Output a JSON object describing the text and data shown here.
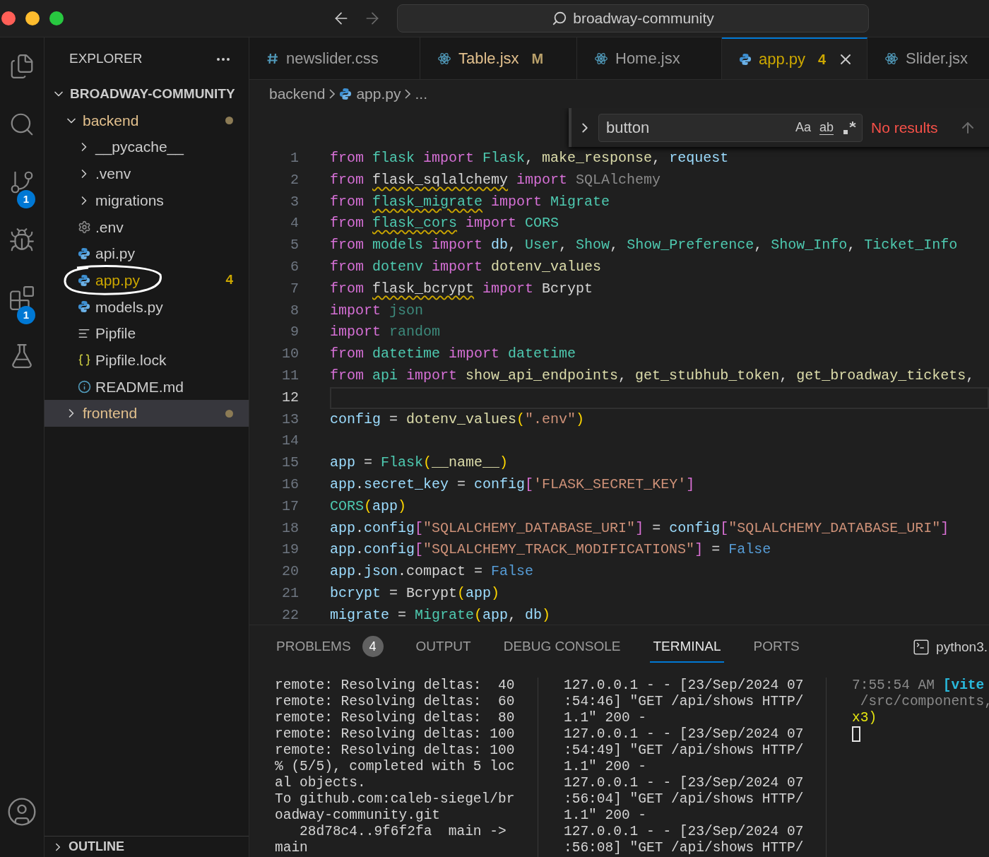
{
  "title_bar": {
    "nav": {
      "back": {
        "disabled": false
      },
      "forward": {
        "disabled": true
      }
    },
    "command_center": "broadway-community"
  },
  "activity_bar": [
    {
      "kind": "files",
      "selected": false
    },
    {
      "kind": "search",
      "selected": false
    },
    {
      "kind": "scm",
      "selected": false,
      "badge": "1"
    },
    {
      "kind": "debug",
      "selected": false
    },
    {
      "kind": "extensions",
      "selected": false,
      "badge": "1"
    },
    {
      "kind": "testing",
      "selected": false
    }
  ],
  "sidebar": {
    "title": "EXPLORER",
    "tree": [
      {
        "label": "BROADWAY-COMMUNITY",
        "kind": "root",
        "modified": false,
        "problems": false,
        "selected": false,
        "expanded": true,
        "circled": false,
        "children": [
          {
            "label": "backend",
            "kind": "folder",
            "modified": true,
            "problems": false,
            "selected": false,
            "expanded": true,
            "circled": false,
            "children": [
              {
                "label": "__pycache__",
                "kind": "folder",
                "modified": false,
                "problems": false,
                "selected": false,
                "expanded": false,
                "circled": false
              },
              {
                "label": ".venv",
                "kind": "folder",
                "modified": false,
                "problems": false,
                "selected": false,
                "expanded": false,
                "circled": false
              },
              {
                "label": "migrations",
                "kind": "folder",
                "modified": false,
                "problems": false,
                "selected": false,
                "expanded": false,
                "circled": false
              },
              {
                "label": ".env",
                "kind": "env",
                "modified": false,
                "problems": false,
                "selected": false,
                "circled": false
              },
              {
                "label": "api.py",
                "kind": "python",
                "modified": false,
                "problems": false,
                "selected": false,
                "circled": false
              },
              {
                "label": "app.py",
                "kind": "python",
                "modified": false,
                "problems": true,
                "badge": "4",
                "selected": false,
                "circled": true
              },
              {
                "label": "models.py",
                "kind": "python",
                "modified": false,
                "problems": false,
                "selected": false,
                "circled": false
              },
              {
                "label": "Pipfile",
                "kind": "text",
                "modified": false,
                "problems": false,
                "selected": false,
                "circled": false
              },
              {
                "label": "Pipfile.lock",
                "kind": "json",
                "modified": false,
                "problems": false,
                "selected": false,
                "circled": false
              },
              {
                "label": "README.md",
                "kind": "info",
                "modified": false,
                "problems": false,
                "selected": false,
                "circled": false
              }
            ]
          },
          {
            "label": "frontend",
            "kind": "folder",
            "modified": true,
            "problems": false,
            "selected": true,
            "expanded": false,
            "circled": false
          }
        ]
      }
    ],
    "outline": {
      "label": "OUTLINE",
      "expanded": false
    }
  },
  "tabs": [
    {
      "label": "newslider.css",
      "kind": "css",
      "modified": false,
      "problems": false,
      "selected": false
    },
    {
      "label": "Table.jsx",
      "kind": "react",
      "modified": true,
      "problems": false,
      "badge": "M",
      "selected": false
    },
    {
      "label": "Home.jsx",
      "kind": "react",
      "modified": false,
      "problems": false,
      "selected": false
    },
    {
      "label": "app.py",
      "kind": "python",
      "modified": false,
      "problems": true,
      "badge": "4",
      "selected": true
    },
    {
      "label": "Slider.jsx",
      "kind": "react",
      "modified": false,
      "problems": false,
      "selected": false
    }
  ],
  "breadcrumbs": [
    {
      "text": "backend",
      "kind": "folder"
    },
    {
      "text": "app.py",
      "kind": "python"
    },
    {
      "text": "...",
      "kind": "more"
    }
  ],
  "find": {
    "value": "button",
    "toggles": [
      "Aa",
      "ab"
    ],
    "result": "No results"
  },
  "code": [
    {
      "n": "1",
      "current": false,
      "tokens": [
        {
          "kind": "kw",
          "text": "from "
        },
        {
          "kind": "mod",
          "text": "flask "
        },
        {
          "kind": "kw",
          "text": "import "
        },
        {
          "kind": "mod",
          "text": "Flask"
        },
        {
          "kind": "plain",
          "text": ", "
        },
        {
          "kind": "fn",
          "text": "make_response"
        },
        {
          "kind": "plain",
          "text": ", "
        },
        {
          "kind": "var",
          "text": "request"
        }
      ]
    },
    {
      "n": "2",
      "current": false,
      "tokens": [
        {
          "kind": "kw",
          "text": "from "
        },
        {
          "kind": "warn",
          "text": "flask_sqlalchemy"
        },
        {
          "kind": "kw",
          "text": " import "
        },
        {
          "kind": "dim",
          "text": "SQLAlchemy"
        }
      ]
    },
    {
      "n": "3",
      "current": false,
      "tokens": [
        {
          "kind": "kw",
          "text": "from "
        },
        {
          "kind": "modwarn",
          "text": "flask_migrate"
        },
        {
          "kind": "kw",
          "text": " import "
        },
        {
          "kind": "mod",
          "text": "Migrate"
        }
      ]
    },
    {
      "n": "4",
      "current": false,
      "tokens": [
        {
          "kind": "kw",
          "text": "from "
        },
        {
          "kind": "modwarn",
          "text": "flask_cors"
        },
        {
          "kind": "kw",
          "text": " import "
        },
        {
          "kind": "mod",
          "text": "CORS"
        }
      ]
    },
    {
      "n": "5",
      "current": false,
      "tokens": [
        {
          "kind": "kw",
          "text": "from "
        },
        {
          "kind": "mod",
          "text": "models "
        },
        {
          "kind": "kw",
          "text": "import "
        },
        {
          "kind": "var",
          "text": "db"
        },
        {
          "kind": "plain",
          "text": ", "
        },
        {
          "kind": "mod",
          "text": "User"
        },
        {
          "kind": "plain",
          "text": ", "
        },
        {
          "kind": "mod",
          "text": "Show"
        },
        {
          "kind": "plain",
          "text": ", "
        },
        {
          "kind": "mod",
          "text": "Show_Preference"
        },
        {
          "kind": "plain",
          "text": ", "
        },
        {
          "kind": "mod",
          "text": "Show_Info"
        },
        {
          "kind": "plain",
          "text": ", "
        },
        {
          "kind": "mod",
          "text": "Ticket_Info"
        }
      ]
    },
    {
      "n": "6",
      "current": false,
      "tokens": [
        {
          "kind": "kw",
          "text": "from "
        },
        {
          "kind": "mod",
          "text": "dotenv "
        },
        {
          "kind": "kw",
          "text": "import "
        },
        {
          "kind": "fn",
          "text": "dotenv_values"
        }
      ]
    },
    {
      "n": "7",
      "current": false,
      "tokens": [
        {
          "kind": "kw",
          "text": "from "
        },
        {
          "kind": "warn",
          "text": "flask_bcrypt"
        },
        {
          "kind": "kw",
          "text": " import "
        },
        {
          "kind": "plain",
          "text": "Bcrypt"
        }
      ]
    },
    {
      "n": "8",
      "current": false,
      "tokens": [
        {
          "kind": "kw",
          "text": "import "
        },
        {
          "kind": "dimmod",
          "text": "json"
        }
      ]
    },
    {
      "n": "9",
      "current": false,
      "tokens": [
        {
          "kind": "kw",
          "text": "import "
        },
        {
          "kind": "dimmod",
          "text": "random"
        }
      ]
    },
    {
      "n": "10",
      "current": false,
      "tokens": [
        {
          "kind": "kw",
          "text": "from "
        },
        {
          "kind": "mod",
          "text": "datetime "
        },
        {
          "kind": "kw",
          "text": "import "
        },
        {
          "kind": "mod",
          "text": "datetime"
        }
      ]
    },
    {
      "n": "11",
      "current": false,
      "tokens": [
        {
          "kind": "kw",
          "text": "from "
        },
        {
          "kind": "mod",
          "text": "api "
        },
        {
          "kind": "kw",
          "text": "import "
        },
        {
          "kind": "fn",
          "text": "show_api_endpoints"
        },
        {
          "kind": "plain",
          "text": ", "
        },
        {
          "kind": "fn",
          "text": "get_stubhub_token"
        },
        {
          "kind": "plain",
          "text": ", "
        },
        {
          "kind": "fn",
          "text": "get_broadway_tickets"
        },
        {
          "kind": "plain",
          "text": ","
        }
      ]
    },
    {
      "n": "12",
      "current": true
    },
    {
      "n": "13",
      "current": false,
      "tokens": [
        {
          "kind": "var",
          "text": "config"
        },
        {
          "kind": "plain",
          "text": " = "
        },
        {
          "kind": "fn",
          "text": "dotenv_values"
        },
        {
          "kind": "b1",
          "text": "("
        },
        {
          "kind": "str",
          "text": "\".env\""
        },
        {
          "kind": "b1",
          "text": ")"
        }
      ]
    },
    {
      "n": "14",
      "current": false
    },
    {
      "n": "15",
      "current": false,
      "tokens": [
        {
          "kind": "var",
          "text": "app"
        },
        {
          "kind": "plain",
          "text": " = "
        },
        {
          "kind": "mod",
          "text": "Flask"
        },
        {
          "kind": "b1",
          "text": "("
        },
        {
          "kind": "fn",
          "text": "__name__"
        },
        {
          "kind": "b1",
          "text": ")"
        }
      ]
    },
    {
      "n": "16",
      "current": false,
      "tokens": [
        {
          "kind": "var",
          "text": "app"
        },
        {
          "kind": "plain",
          "text": "."
        },
        {
          "kind": "var",
          "text": "secret_key"
        },
        {
          "kind": "plain",
          "text": " = "
        },
        {
          "kind": "var",
          "text": "config"
        },
        {
          "kind": "b2",
          "text": "["
        },
        {
          "kind": "str",
          "text": "'FLASK_SECRET_KEY'"
        },
        {
          "kind": "b2",
          "text": "]"
        }
      ]
    },
    {
      "n": "17",
      "current": false,
      "tokens": [
        {
          "kind": "mod",
          "text": "CORS"
        },
        {
          "kind": "b1",
          "text": "("
        },
        {
          "kind": "var",
          "text": "app"
        },
        {
          "kind": "b1",
          "text": ")"
        }
      ]
    },
    {
      "n": "18",
      "current": false,
      "tokens": [
        {
          "kind": "var",
          "text": "app"
        },
        {
          "kind": "plain",
          "text": "."
        },
        {
          "kind": "var",
          "text": "config"
        },
        {
          "kind": "b2",
          "text": "["
        },
        {
          "kind": "str",
          "text": "\"SQLALCHEMY_DATABASE_URI\""
        },
        {
          "kind": "b2",
          "text": "]"
        },
        {
          "kind": "plain",
          "text": " = "
        },
        {
          "kind": "var",
          "text": "config"
        },
        {
          "kind": "b2",
          "text": "["
        },
        {
          "kind": "str",
          "text": "\"SQLALCHEMY_DATABASE_URI\""
        },
        {
          "kind": "b2",
          "text": "]"
        }
      ]
    },
    {
      "n": "19",
      "current": false,
      "tokens": [
        {
          "kind": "var",
          "text": "app"
        },
        {
          "kind": "plain",
          "text": "."
        },
        {
          "kind": "var",
          "text": "config"
        },
        {
          "kind": "b2",
          "text": "["
        },
        {
          "kind": "str",
          "text": "\"SQLALCHEMY_TRACK_MODIFICATIONS\""
        },
        {
          "kind": "b2",
          "text": "]"
        },
        {
          "kind": "plain",
          "text": " = "
        },
        {
          "kind": "const",
          "text": "False"
        }
      ]
    },
    {
      "n": "20",
      "current": false,
      "tokens": [
        {
          "kind": "var",
          "text": "app"
        },
        {
          "kind": "plain",
          "text": "."
        },
        {
          "kind": "var",
          "text": "json"
        },
        {
          "kind": "plain",
          "text": ".compact = "
        },
        {
          "kind": "const",
          "text": "False"
        }
      ]
    },
    {
      "n": "21",
      "current": false,
      "tokens": [
        {
          "kind": "var",
          "text": "bcrypt"
        },
        {
          "kind": "plain",
          "text": " = Bcrypt"
        },
        {
          "kind": "b1",
          "text": "("
        },
        {
          "kind": "var",
          "text": "app"
        },
        {
          "kind": "b1",
          "text": ")"
        }
      ]
    },
    {
      "n": "22",
      "current": false,
      "tokens": [
        {
          "kind": "var",
          "text": "migrate"
        },
        {
          "kind": "plain",
          "text": " = "
        },
        {
          "kind": "mod",
          "text": "Migrate"
        },
        {
          "kind": "b1",
          "text": "("
        },
        {
          "kind": "var",
          "text": "app"
        },
        {
          "kind": "plain",
          "text": ", "
        },
        {
          "kind": "var",
          "text": "db"
        },
        {
          "kind": "b1",
          "text": ")"
        }
      ]
    }
  ],
  "panel": {
    "tabs": [
      {
        "label": "PROBLEMS",
        "badge": "4",
        "selected": false
      },
      {
        "label": "OUTPUT",
        "selected": false
      },
      {
        "label": "DEBUG CONSOLE",
        "selected": false
      },
      {
        "label": "TERMINAL",
        "selected": true
      },
      {
        "label": "PORTS",
        "selected": false
      }
    ],
    "terminal_name": "python3.",
    "panes": [
      {
        "lines": [
          [
            {
              "kind": "plain",
              "text": "remote: Resolving deltas:  40"
            }
          ],
          [
            {
              "kind": "plain",
              "text": "remote: Resolving deltas:  60"
            }
          ],
          [
            {
              "kind": "plain",
              "text": "remote: Resolving deltas:  80"
            }
          ],
          [
            {
              "kind": "plain",
              "text": "remote: Resolving deltas: 100"
            }
          ],
          [
            {
              "kind": "plain",
              "text": "remote: Resolving deltas: 100"
            }
          ],
          [
            {
              "kind": "plain",
              "text": "% (5/5), completed with 5 loc"
            }
          ],
          [
            {
              "kind": "plain",
              "text": "al objects."
            }
          ],
          [
            {
              "kind": "plain",
              "text": "To github.com:caleb-siegel/br"
            }
          ],
          [
            {
              "kind": "plain",
              "text": "oadway-community.git"
            }
          ],
          [
            {
              "kind": "plain",
              "text": "   28d78c4..9f6f2fa  main ->"
            }
          ],
          [
            {
              "kind": "plain",
              "text": "main"
            }
          ]
        ]
      },
      {
        "lines": [
          [
            {
              "kind": "plain",
              "text": "127.0.0.1 - - [23/Sep/2024 07"
            }
          ],
          [
            {
              "kind": "plain",
              "text": ":54:46] \"GET /api/shows HTTP/"
            }
          ],
          [
            {
              "kind": "plain",
              "text": "1.1\" 200 -"
            }
          ],
          [
            {
              "kind": "plain",
              "text": "127.0.0.1 - - [23/Sep/2024 07"
            }
          ],
          [
            {
              "kind": "plain",
              "text": ":54:49] \"GET /api/shows HTTP/"
            }
          ],
          [
            {
              "kind": "plain",
              "text": "1.1\" 200 -"
            }
          ],
          [
            {
              "kind": "plain",
              "text": "127.0.0.1 - - [23/Sep/2024 07"
            }
          ],
          [
            {
              "kind": "plain",
              "text": ":56:04] \"GET /api/shows HTTP/"
            }
          ],
          [
            {
              "kind": "plain",
              "text": "1.1\" 200 -"
            }
          ],
          [
            {
              "kind": "plain",
              "text": "127.0.0.1 - - [23/Sep/2024 07"
            }
          ],
          [
            {
              "kind": "plain",
              "text": ":56:08] \"GET /api/shows HTTP/"
            }
          ]
        ]
      },
      {
        "lines": [
          [
            {
              "kind": "dim",
              "text": "7:55:54 AM "
            },
            {
              "kind": "cyan",
              "text": "[vite"
            }
          ],
          [
            {
              "kind": "dim",
              "text": " /src/components,"
            }
          ],
          [
            {
              "kind": "yellow",
              "text": "x3)"
            }
          ]
        ],
        "cursor": true
      }
    ]
  }
}
